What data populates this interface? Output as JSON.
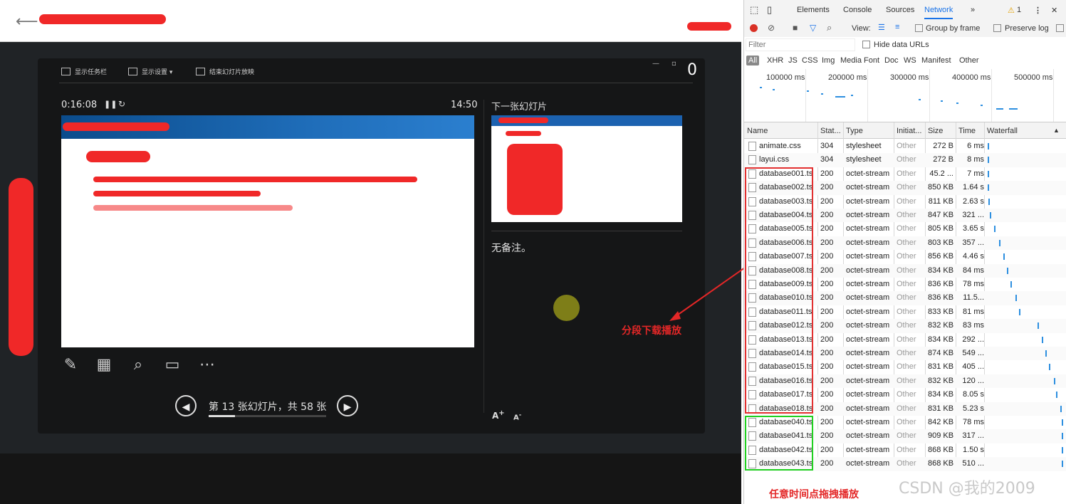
{
  "presenter": {
    "toolbar": {
      "show_taskbar": "显示任务栏",
      "display_settings": "显示设置 ▾",
      "end_slideshow": "结束幻灯片放映"
    },
    "timer": "0:16:08",
    "clock": "14:50",
    "next_slide_label": "下一张幻灯片",
    "notes": "无备注。",
    "slide_counter": "第 13 张幻灯片，共 58 张",
    "progress_fraction": 0.224,
    "window_close": "0"
  },
  "devtools": {
    "tabs": [
      "Elements",
      "Console",
      "Sources",
      "Network",
      "»"
    ],
    "active_tab": "Network",
    "warning_count": "1",
    "toolbar": {
      "view_label": "View:",
      "group_by_frame": "Group by frame",
      "preserve_log": "Preserve log"
    },
    "filter_placeholder": "Filter",
    "hide_data_urls": "Hide data URLs",
    "type_filters": [
      "All",
      "XHR",
      "JS",
      "CSS",
      "Img",
      "Media",
      "Font",
      "Doc",
      "WS",
      "Manifest",
      "Other"
    ],
    "timeline_labels": [
      "100000 ms",
      "200000 ms",
      "300000 ms",
      "400000 ms",
      "500000 ms"
    ],
    "columns": [
      "Name",
      "Stat...",
      "Type",
      "Initiat...",
      "Size",
      "Time",
      "Waterfall"
    ],
    "rows": [
      {
        "name": "animate.css",
        "status": "304",
        "type": "stylesheet",
        "initiator": "Other",
        "size": "272 B",
        "time": "6 ms",
        "wf": 0.01
      },
      {
        "name": "layui.css",
        "status": "304",
        "type": "stylesheet",
        "initiator": "Other",
        "size": "272 B",
        "time": "8 ms",
        "wf": 0.01
      },
      {
        "name": "database001.ts",
        "status": "200",
        "type": "octet-stream",
        "initiator": "Other",
        "size": "45.2 ...",
        "time": "7 ms",
        "wf": 0.01
      },
      {
        "name": "database002.ts",
        "status": "200",
        "type": "octet-stream",
        "initiator": "Other",
        "size": "850 KB",
        "time": "1.64 s",
        "wf": 0.01
      },
      {
        "name": "database003.ts",
        "status": "200",
        "type": "octet-stream",
        "initiator": "Other",
        "size": "811 KB",
        "time": "2.63 s",
        "wf": 0.02
      },
      {
        "name": "database004.ts",
        "status": "200",
        "type": "octet-stream",
        "initiator": "Other",
        "size": "847 KB",
        "time": "321 ...",
        "wf": 0.04
      },
      {
        "name": "database005.ts",
        "status": "200",
        "type": "octet-stream",
        "initiator": "Other",
        "size": "805 KB",
        "time": "3.65 s",
        "wf": 0.09
      },
      {
        "name": "database006.ts",
        "status": "200",
        "type": "octet-stream",
        "initiator": "Other",
        "size": "803 KB",
        "time": "357 ...",
        "wf": 0.16
      },
      {
        "name": "database007.ts",
        "status": "200",
        "type": "octet-stream",
        "initiator": "Other",
        "size": "856 KB",
        "time": "4.46 s",
        "wf": 0.21
      },
      {
        "name": "database008.ts",
        "status": "200",
        "type": "octet-stream",
        "initiator": "Other",
        "size": "834 KB",
        "time": "84 ms",
        "wf": 0.26
      },
      {
        "name": "database009.ts",
        "status": "200",
        "type": "octet-stream",
        "initiator": "Other",
        "size": "836 KB",
        "time": "78 ms",
        "wf": 0.31
      },
      {
        "name": "database010.ts",
        "status": "200",
        "type": "octet-stream",
        "initiator": "Other",
        "size": "836 KB",
        "time": "11.5...",
        "wf": 0.37
      },
      {
        "name": "database011.ts",
        "status": "200",
        "type": "octet-stream",
        "initiator": "Other",
        "size": "833 KB",
        "time": "81 ms",
        "wf": 0.42
      },
      {
        "name": "database012.ts",
        "status": "200",
        "type": "octet-stream",
        "initiator": "Other",
        "size": "832 KB",
        "time": "83 ms",
        "wf": 0.66
      },
      {
        "name": "database013.ts",
        "status": "200",
        "type": "octet-stream",
        "initiator": "Other",
        "size": "834 KB",
        "time": "292 ...",
        "wf": 0.71
      },
      {
        "name": "database014.ts",
        "status": "200",
        "type": "octet-stream",
        "initiator": "Other",
        "size": "874 KB",
        "time": "549 ...",
        "wf": 0.76
      },
      {
        "name": "database015.ts",
        "status": "200",
        "type": "octet-stream",
        "initiator": "Other",
        "size": "831 KB",
        "time": "405 ...",
        "wf": 0.81
      },
      {
        "name": "database016.ts",
        "status": "200",
        "type": "octet-stream",
        "initiator": "Other",
        "size": "832 KB",
        "time": "120 ...",
        "wf": 0.87
      },
      {
        "name": "database017.ts",
        "status": "200",
        "type": "octet-stream",
        "initiator": "Other",
        "size": "834 KB",
        "time": "8.05 s",
        "wf": 0.9
      },
      {
        "name": "database018.ts",
        "status": "200",
        "type": "octet-stream",
        "initiator": "Other",
        "size": "831 KB",
        "time": "5.23 s",
        "wf": 0.95
      },
      {
        "name": "database040.ts",
        "status": "200",
        "type": "octet-stream",
        "initiator": "Other",
        "size": "842 KB",
        "time": "78 ms",
        "wf": 0.97
      },
      {
        "name": "database041.ts",
        "status": "200",
        "type": "octet-stream",
        "initiator": "Other",
        "size": "909 KB",
        "time": "317 ...",
        "wf": 0.97
      },
      {
        "name": "database042.ts",
        "status": "200",
        "type": "octet-stream",
        "initiator": "Other",
        "size": "868 KB",
        "time": "1.50 s",
        "wf": 0.97
      },
      {
        "name": "database043.ts",
        "status": "200",
        "type": "octet-stream",
        "initiator": "Other",
        "size": "868 KB",
        "time": "510 ...",
        "wf": 0.97
      }
    ]
  },
  "annotations": {
    "red": "分段下载播放",
    "green": "任意时间点拖拽播放"
  },
  "watermark": "CSDN @我的2009",
  "colors": {
    "annotation_red": "#e32727",
    "annotation_green": "#20d020",
    "waterfall_blue": "#2d8fe0",
    "record_red": "#d93025"
  }
}
